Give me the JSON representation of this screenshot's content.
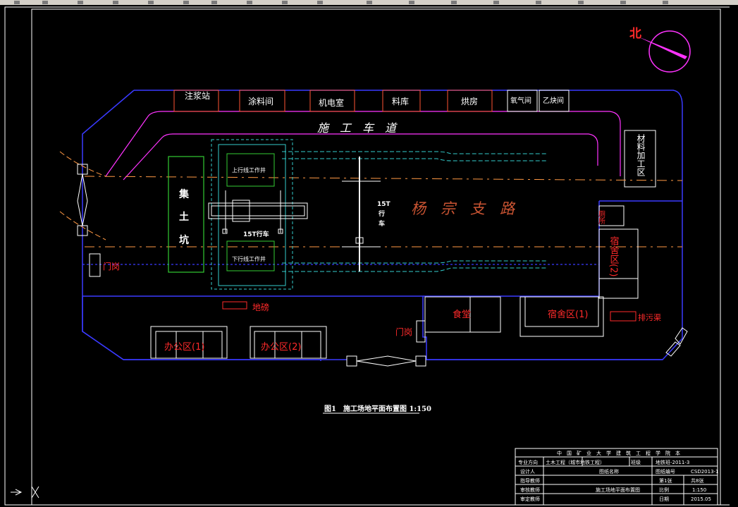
{
  "compass": {
    "north_label": "北"
  },
  "facilities_top": [
    "注浆站",
    "涂料间",
    "机电室",
    "料库",
    "烘房",
    "氧气间",
    "乙炔间"
  ],
  "road_label": "施　工　车　道",
  "material_area": "材料加工区",
  "pit_label": [
    "集",
    "土",
    "坑"
  ],
  "upper_shaft": "上行线工作井",
  "lower_shaft": "下行线工作井",
  "crane_15t_a": "15T行车",
  "crane_15t_b": [
    "15T",
    "行",
    "车"
  ],
  "street_label": "杨　宗　支　路",
  "gate_left": "门岗",
  "gate_right": "门岗",
  "platform": "地磅",
  "right_small_box": "厕所",
  "dorm2": "宿舍区(2)",
  "dorm1": "宿舍区(1)",
  "canteen": "食堂",
  "sign": "排污渠",
  "office1": "办公区(1)",
  "office2": "办公区(2)",
  "figure_caption": "图1　施工场地平面布置图 1:150",
  "title_block": {
    "header": "中　国　矿　业　大　学　建　筑　工　程　学　院　本",
    "rows": [
      [
        "专业方向",
        "土木工程（城市地铁工程）",
        "班级",
        "地铁班-2011-3"
      ],
      [
        "设计人",
        "",
        "图纸名称",
        "图纸编号",
        "CSD2013-1"
      ],
      [
        "指导教师",
        "",
        "",
        "第1张",
        "共8张"
      ],
      [
        "审核教师",
        "",
        "施工场地平面布置图",
        "比例",
        "1:150"
      ],
      [
        "审定教师",
        "",
        "",
        "日期",
        "2015.05"
      ]
    ]
  },
  "colors": {
    "boundary": "#3a3aff",
    "road": "#ff33ff",
    "facility": "#ff5533",
    "text": "#ffffff",
    "label_red": "#ff2a2a",
    "pit": "#33cc33",
    "shaft": "#33cccc"
  }
}
